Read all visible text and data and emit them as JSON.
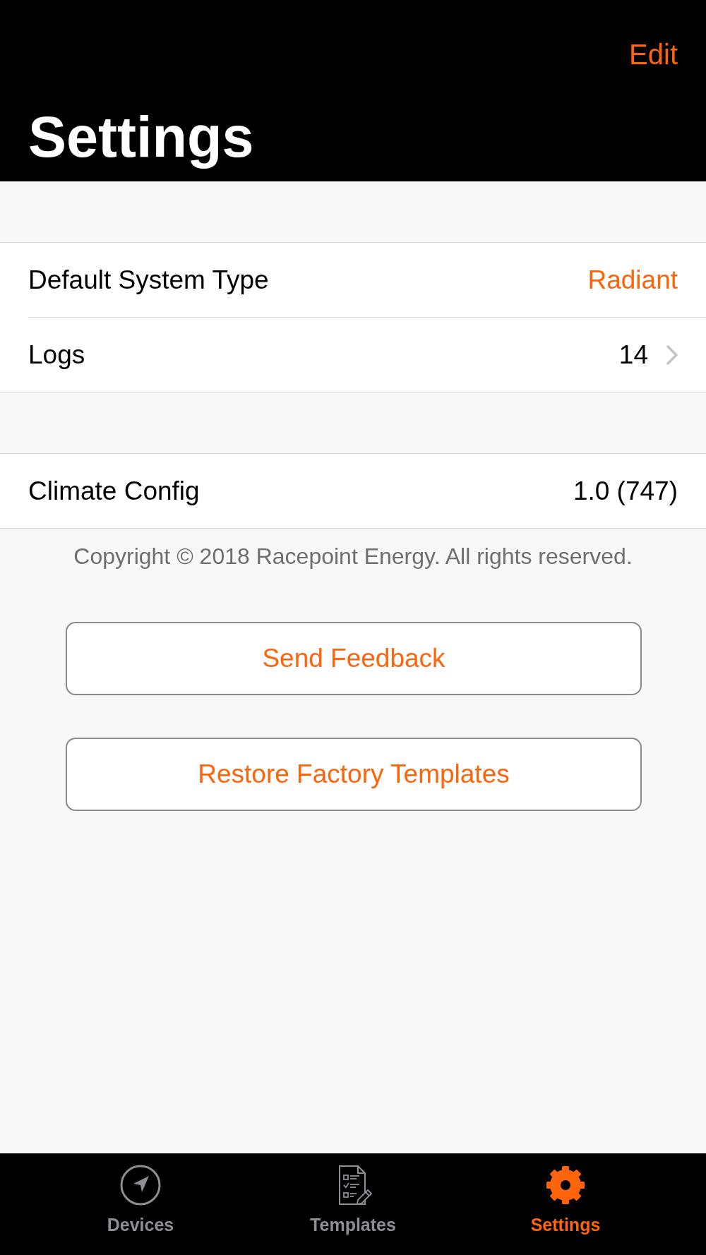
{
  "header": {
    "edit": "Edit",
    "title": "Settings"
  },
  "sections": [
    {
      "rows": [
        {
          "kind": "choice",
          "label": "Default System Type",
          "value": "Radiant"
        },
        {
          "kind": "link",
          "label": "Logs",
          "value": "14"
        }
      ]
    },
    {
      "rows": [
        {
          "kind": "info",
          "label": "Climate Config",
          "value": "1.0 (747)"
        }
      ]
    }
  ],
  "copyright": "Copyright © 2018 Racepoint Energy. All rights reserved.",
  "buttons": [
    "Send Feedback",
    "Restore Factory Templates"
  ],
  "tab_bar": [
    {
      "label": "Devices",
      "selected": false
    },
    {
      "label": "Templates",
      "selected": false
    },
    {
      "label": "Settings",
      "selected": true
    }
  ]
}
